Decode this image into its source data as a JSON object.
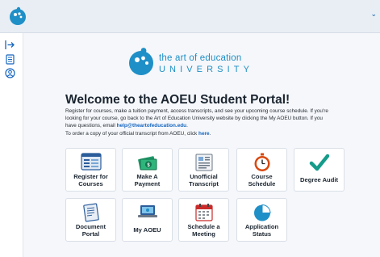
{
  "brand": {
    "line1": "the art of education",
    "line2": "UNIVERSITY"
  },
  "welcome": {
    "title": "Welcome to the AOEU Student Portal!",
    "p1": "Register for courses, make a tuition payment, access transcripts, and see your upcoming course schedule. If you're looking for your course, go back to the Art of Education University website by clicking the My AOEU button. If you have questions, email ",
    "email": "help@theartofeducation.edu",
    "p1_end": ".",
    "p2": "To order a copy of your official transcript from AOEU, click ",
    "here": "here",
    "p2_end": "."
  },
  "tiles": [
    {
      "line1": "Register for",
      "line2": "Courses",
      "icon": "register-icon"
    },
    {
      "line1": "Make A",
      "line2": "Payment",
      "icon": "payment-icon"
    },
    {
      "line1": "Unofficial",
      "line2": "Transcript",
      "icon": "transcript-icon"
    },
    {
      "line1": "Course",
      "line2": "Schedule",
      "icon": "stopwatch-icon"
    },
    {
      "line1": "Degree Audit",
      "line2": "",
      "icon": "checkmark-icon"
    },
    {
      "line1": "Document",
      "line2": "Portal",
      "icon": "document-icon"
    },
    {
      "line1": "My AOEU",
      "line2": "",
      "icon": "laptop-icon"
    },
    {
      "line1": "Schedule a",
      "line2": "Meeting",
      "icon": "calendar-icon"
    },
    {
      "line1": "Application",
      "line2": "Status",
      "icon": "pie-chart-icon"
    }
  ],
  "colors": {
    "brand_blue": "#1f8fc7",
    "link_blue": "#1565c0",
    "topbar": "#e9eef5",
    "green": "#1f9a6b"
  }
}
